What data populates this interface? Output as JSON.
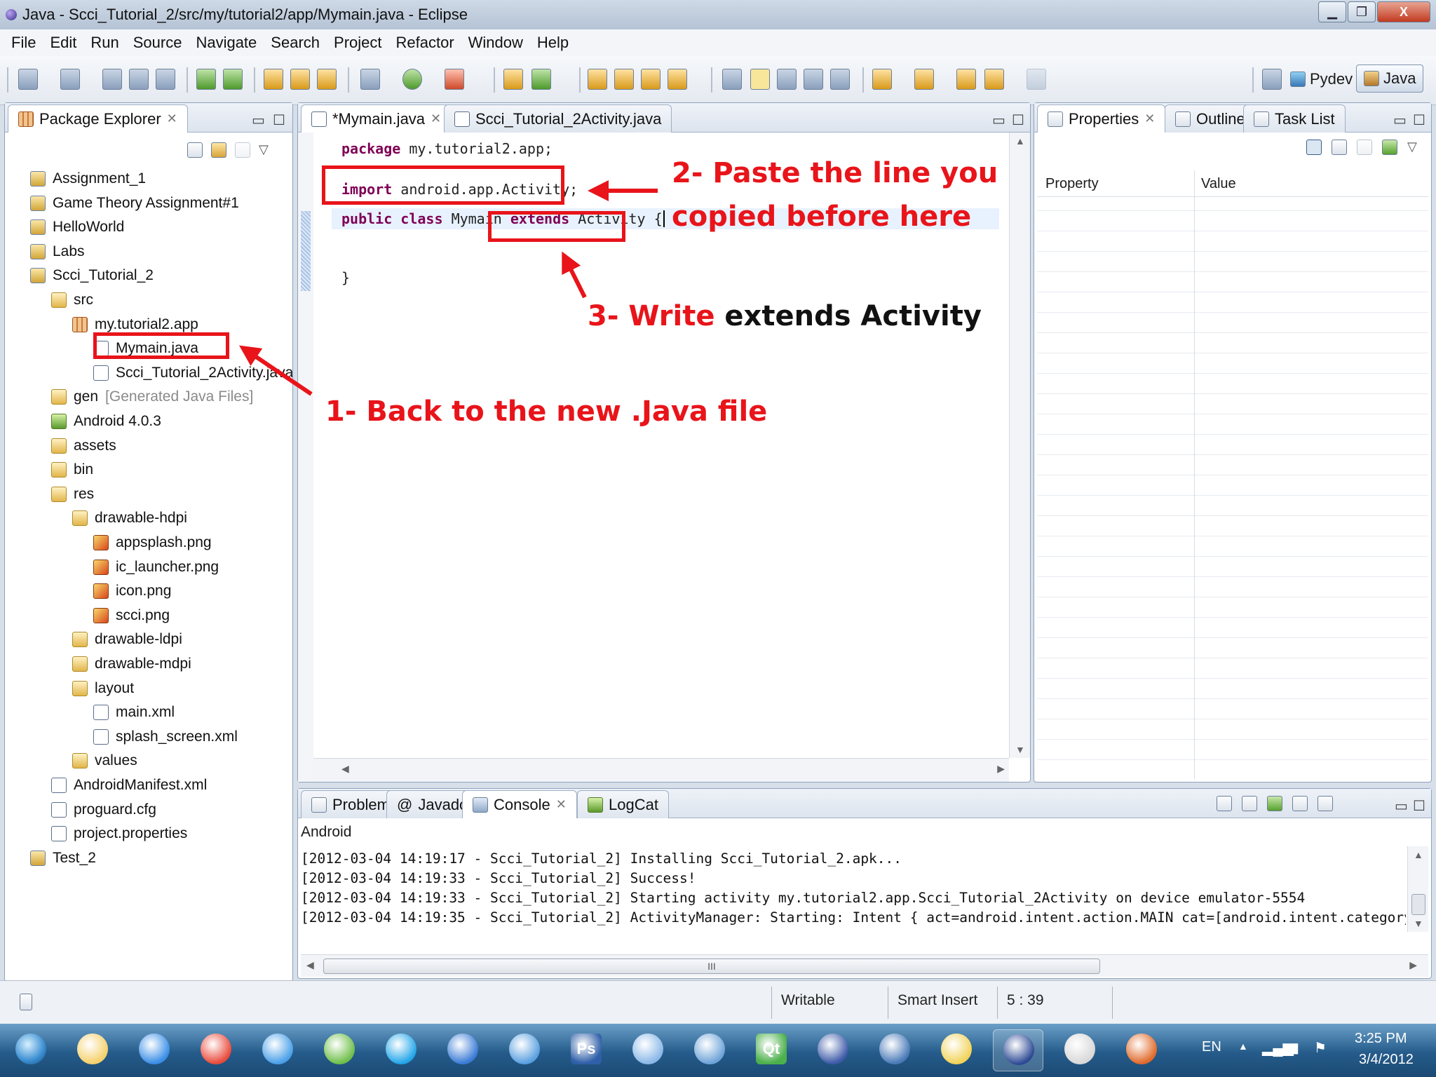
{
  "window": {
    "title": "Java - Scci_Tutorial_2/src/my/tutorial2/app/Mymain.java - Eclipse",
    "min": "▁",
    "max": "❐",
    "close": "X"
  },
  "menubar": [
    "File",
    "Edit",
    "Run",
    "Source",
    "Navigate",
    "Search",
    "Project",
    "Refactor",
    "Window",
    "Help"
  ],
  "toolbar": {
    "perspective_pydev": "Pydev",
    "perspective_java": "Java"
  },
  "package_explorer": {
    "tab_label": "Package Explorer",
    "tree": [
      {
        "label": "Assignment_1",
        "icon": "project-icon",
        "depth": 0
      },
      {
        "label": "Game Theory Assignment#1",
        "icon": "project-icon",
        "depth": 0
      },
      {
        "label": "HelloWorld",
        "icon": "project-icon",
        "depth": 0
      },
      {
        "label": "Labs",
        "icon": "project-icon",
        "depth": 0
      },
      {
        "label": "Scci_Tutorial_2",
        "icon": "project-icon",
        "depth": 0
      },
      {
        "label": "src",
        "icon": "source-folder-icon",
        "depth": 1
      },
      {
        "label": "my.tutorial2.app",
        "icon": "package-icon",
        "depth": 2
      },
      {
        "label": "Mymain.java",
        "icon": "java-file-icon",
        "depth": 3
      },
      {
        "label": "Scci_Tutorial_2Activity.java",
        "icon": "java-file-icon",
        "depth": 3
      },
      {
        "label": "gen",
        "suffix": "[Generated Java Files]",
        "icon": "source-folder-icon",
        "depth": 1
      },
      {
        "label": "Android 4.0.3",
        "icon": "library-icon",
        "depth": 1
      },
      {
        "label": "assets",
        "icon": "folder-icon",
        "depth": 1
      },
      {
        "label": "bin",
        "icon": "folder-icon",
        "depth": 1
      },
      {
        "label": "res",
        "icon": "folder-icon",
        "depth": 1
      },
      {
        "label": "drawable-hdpi",
        "icon": "folder-icon",
        "depth": 2
      },
      {
        "label": "appsplash.png",
        "icon": "image-file-icon",
        "depth": 3
      },
      {
        "label": "ic_launcher.png",
        "icon": "image-file-icon",
        "depth": 3
      },
      {
        "label": "icon.png",
        "icon": "image-file-icon",
        "depth": 3
      },
      {
        "label": "scci.png",
        "icon": "image-file-icon",
        "depth": 3
      },
      {
        "label": "drawable-ldpi",
        "icon": "folder-icon",
        "depth": 2
      },
      {
        "label": "drawable-mdpi",
        "icon": "folder-icon",
        "depth": 2
      },
      {
        "label": "layout",
        "icon": "folder-icon",
        "depth": 2
      },
      {
        "label": "main.xml",
        "icon": "xml-file-icon",
        "depth": 3
      },
      {
        "label": "splash_screen.xml",
        "icon": "xml-file-icon",
        "depth": 3
      },
      {
        "label": "values",
        "icon": "folder-icon",
        "depth": 2
      },
      {
        "label": "AndroidManifest.xml",
        "icon": "manifest-file-icon",
        "depth": 1
      },
      {
        "label": "proguard.cfg",
        "icon": "text-file-icon",
        "depth": 1
      },
      {
        "label": "project.properties",
        "icon": "text-file-icon",
        "depth": 1
      },
      {
        "label": "Test_2",
        "icon": "project-icon",
        "depth": 0
      }
    ]
  },
  "editor": {
    "tabs": [
      "*Mymain.java",
      "Scci_Tutorial_2Activity.java"
    ],
    "lines": {
      "package_kw": "package",
      "package_rest": " my.tutorial2.app;",
      "import_kw": "import",
      "import_rest": " android.app.Activity;",
      "public_kw": "public",
      "class_kw": "class",
      "class_name": "Mymain",
      "extends_kw": "extends",
      "superclass": "Activity",
      "open_brace": "{",
      "close_brace": "}"
    }
  },
  "annotations": {
    "step1": "1- Back to the new .Java file",
    "step2_line1": "2- Paste the line you",
    "step2_line2": "copied before here",
    "step3_prefix": "3- Write",
    "step3_suffix": "extends Activity"
  },
  "right_panel": {
    "tabs": [
      "Properties",
      "Outline",
      "Task List"
    ],
    "col_property": "Property",
    "col_value": "Value"
  },
  "console": {
    "tabs": [
      "Problems",
      "Javadoc",
      "Console",
      "LogCat"
    ],
    "header": "Android",
    "lines": [
      "[2012-03-04 14:19:17 - Scci_Tutorial_2] Installing Scci_Tutorial_2.apk...",
      "[2012-03-04 14:19:33 - Scci_Tutorial_2] Success!",
      "[2012-03-04 14:19:33 - Scci_Tutorial_2] Starting activity my.tutorial2.app.Scci_Tutorial_2Activity on device emulator-5554",
      "[2012-03-04 14:19:35 - Scci_Tutorial_2] ActivityManager: Starting: Intent { act=android.intent.action.MAIN cat=[android.intent.category.LAUNC"
    ],
    "hscroll_grip": "III"
  },
  "statusbar": {
    "writable": "Writable",
    "insert_mode": "Smart Insert",
    "position": "5 : 39"
  },
  "taskbar": {
    "lang": "EN",
    "time": "3:25 PM",
    "date": "3/4/2012",
    "apps": [
      "start-orb",
      "explorer",
      "internet-explorer",
      "chrome",
      "safari",
      "messenger",
      "skype",
      "itunes",
      "quicktime",
      "photoshop",
      "paint",
      "infinity-app",
      "qt-creator",
      "eclipse",
      "city-app",
      "sticky-notes",
      "eclipse-active",
      "viewer-app",
      "office-app"
    ],
    "ps_label": "Ps",
    "qt_label": "Qt"
  },
  "colors": {
    "annotation_red": "#e8141a",
    "keyword_purple": "#7f0055"
  }
}
